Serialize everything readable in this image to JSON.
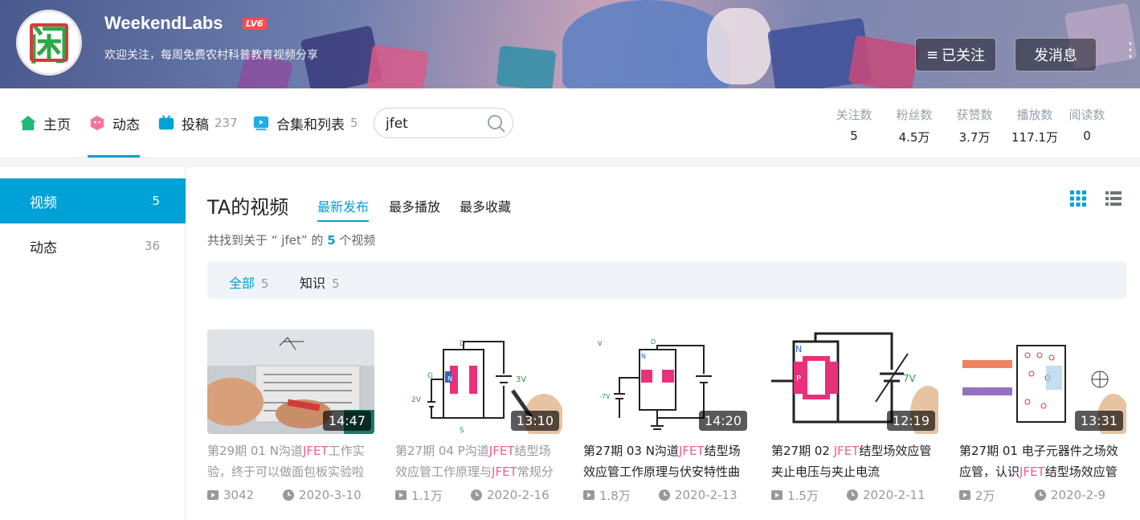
{
  "header": {
    "username": "WeekendLabs",
    "level": "LV6",
    "sign": "欢迎关注，每周免费农村科普教育视频分享",
    "avatar_glyph": "闲",
    "follow_label": "已关注",
    "message_label": "发消息"
  },
  "nav": {
    "home": "主页",
    "dynamic": "动态",
    "contribute": "投稿",
    "contribute_count": "237",
    "collections": "合集和列表",
    "collections_count": "5",
    "search_value": "jfet",
    "active_color": "#00a1d6"
  },
  "stats": [
    {
      "label": "关注数",
      "value": "5"
    },
    {
      "label": "粉丝数",
      "value": "4.5万"
    },
    {
      "label": "获赞数",
      "value": "3.7万"
    },
    {
      "label": "播放数",
      "value": "117.1万"
    },
    {
      "label": "阅读数",
      "value": "0"
    }
  ],
  "sidebar": {
    "items": [
      {
        "label": "视频",
        "count": "5"
      },
      {
        "label": "动态",
        "count": "36"
      }
    ]
  },
  "main": {
    "title": "TA的视频",
    "orders": [
      "最新发布",
      "最多播放",
      "最多收藏"
    ],
    "result_prefix": "共找到关于 “ jfet” 的",
    "result_count": "5",
    "result_suffix": "个视频",
    "tags": [
      {
        "label": "全部",
        "count": "5"
      },
      {
        "label": "知识",
        "count": "5"
      }
    ]
  },
  "videos": [
    {
      "pre": "第29期 01 N沟道",
      "hl": "JFET",
      "post": "工作实验，终于可以做面包板实验啦",
      "hl2": "",
      "post2": "",
      "duration": "14:47",
      "plays": "3042",
      "date": "2020-3-10"
    },
    {
      "pre": "第27期 04 P沟道",
      "hl": "JFET",
      "post": "结型场效应管工作原理与",
      "hl2": "JFET",
      "post2": "常规分",
      "duration": "13:10",
      "plays": "1.1万",
      "date": "2020-2-16"
    },
    {
      "pre": "第27期 03 N沟道",
      "hl": "JFET",
      "post": "结型场效应管工作原理与伏安特性曲",
      "hl2": "",
      "post2": "",
      "duration": "14:20",
      "plays": "1.8万",
      "date": "2020-2-13"
    },
    {
      "pre": "第27期 02 ",
      "hl": "JFET",
      "post": "结型场效应管夹止电压与夹止电流",
      "hl2": "",
      "post2": "",
      "duration": "12:19",
      "plays": "1.5万",
      "date": "2020-2-11"
    },
    {
      "pre": "第27期 01 电子元器件之场效应管，认识",
      "hl": "JFET",
      "post": "结型场效应管",
      "hl2": "",
      "post2": "",
      "duration": "13:31",
      "plays": "2万",
      "date": "2020-2-9"
    }
  ],
  "icons": {
    "home": "home-icon",
    "dynamic": "dynamic-icon",
    "contribute": "tv-icon",
    "collections": "playlist-icon",
    "search": "search-icon",
    "grid_view": "grid-view-icon",
    "list_view": "list-view-icon",
    "play": "play-count-icon",
    "clock": "clock-icon"
  }
}
